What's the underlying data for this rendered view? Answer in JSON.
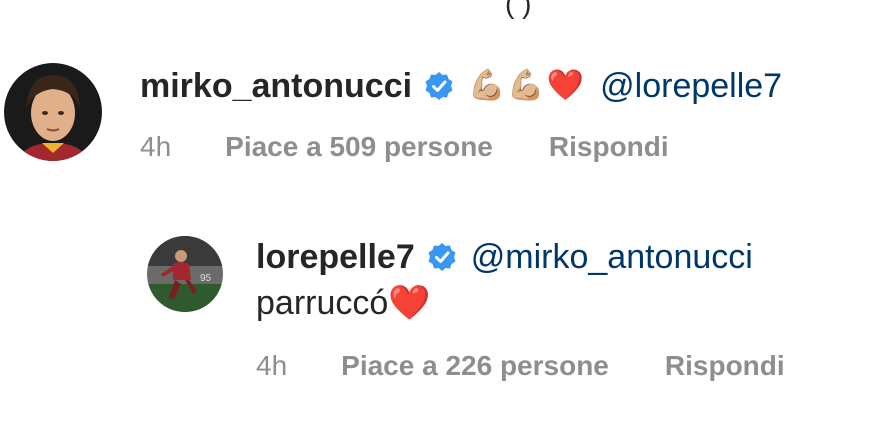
{
  "comments": [
    {
      "username": "mirko_antonucci",
      "verified": true,
      "emoji": "💪🏼💪🏼❤️",
      "mention": "@lorepelle7",
      "time": "4h",
      "likes": "Piace a 509 persone",
      "reply": "Rispondi"
    },
    {
      "username": "lorepelle7",
      "verified": true,
      "mention": "@mirko_antonucci",
      "text": "parruccó",
      "emoji": "❤️",
      "time": "4h",
      "likes": "Piace a 226 persone",
      "reply": "Rispondi"
    }
  ],
  "colors": {
    "verified_badge": "#3897f0",
    "mention": "#00376b",
    "meta": "#8e8e8e",
    "heart": "#ed1c24"
  }
}
